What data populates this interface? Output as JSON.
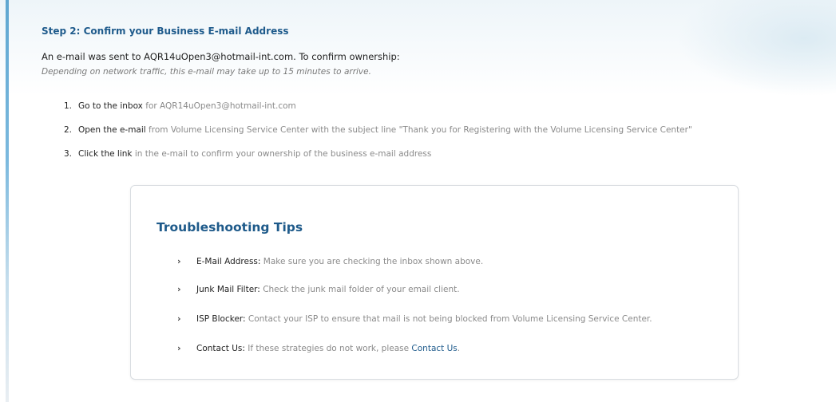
{
  "step": {
    "title": "Step 2: Confirm your Business E-mail Address",
    "intro": "An e-mail was sent to AQR14uOpen3@hotmail-int.com. To confirm ownership:",
    "note": "Depending on network traffic, this e-mail may take up to 15 minutes to arrive."
  },
  "steps": [
    {
      "number": "1.",
      "lead": "Go to the inbox",
      "rest": " for AQR14uOpen3@hotmail-int.com"
    },
    {
      "number": "2.",
      "lead": "Open the e-mail",
      "rest": " from Volume Licensing Service Center with the subject line \"Thank you for Registering with the Volume Licensing Service Center\""
    },
    {
      "number": "3.",
      "lead": "Click the link",
      "rest": " in the e-mail to confirm your ownership of the business e-mail address"
    }
  ],
  "tips": {
    "title": "Troubleshooting Tips",
    "chevron": "›",
    "items": [
      {
        "label": "E-Mail Address:",
        "text": " Make sure you are checking the inbox shown above."
      },
      {
        "label": "Junk Mail Filter:",
        "text": " Check the junk mail folder of your email client."
      },
      {
        "label": "ISP Blocker:",
        "text": " Contact your ISP to ensure that mail is not being blocked from Volume Licensing Service Center."
      },
      {
        "label": "Contact Us:",
        "text": " If these strategies do not work, please ",
        "link": "Contact Us",
        "after": "."
      }
    ]
  }
}
